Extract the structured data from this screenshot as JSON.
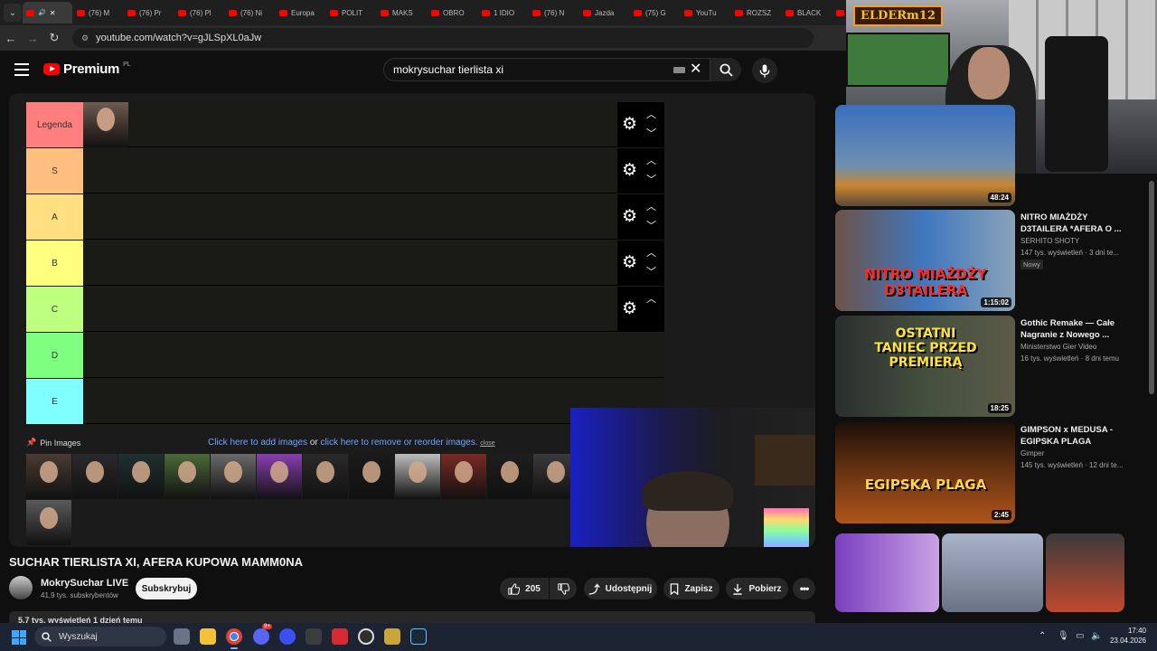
{
  "browser": {
    "tabs": [
      "",
      "(76) M",
      "(76) Pr",
      "(76) Pl",
      "(76) Ni",
      "Europa",
      "POLIT",
      "MAKS",
      "OBRO",
      "1 IDIO",
      "(76) N",
      "Jazda",
      "(75) G",
      "YouTu",
      "ROZSZ",
      "BLACK",
      "("
    ],
    "url": "youtube.com/watch?v=gJLSpXL0aJw"
  },
  "youtube": {
    "logo_word": "Premium",
    "logo_country": "PL",
    "search_query": "mokrysuchar tierlista xi"
  },
  "tierlist": {
    "tiers": [
      {
        "label": "Legenda",
        "color": "#ff7f7f"
      },
      {
        "label": "S",
        "color": "#ffbf7f"
      },
      {
        "label": "A",
        "color": "#ffdf7f"
      },
      {
        "label": "B",
        "color": "#ffff7f"
      },
      {
        "label": "C",
        "color": "#bfff7f"
      },
      {
        "label": "D",
        "color": "#7fff7f"
      },
      {
        "label": "E",
        "color": "#7fffff"
      }
    ],
    "pin_label": "Pin Images",
    "add_link": "Click here to add images",
    "or_text": "or",
    "remove_link": "click here to remove or reorder images.",
    "close_link": "close"
  },
  "stream_logo": "ELDER",
  "recommendations": [
    {
      "title": "",
      "channel": "",
      "meta": "",
      "duration": "48:24",
      "badge": ""
    },
    {
      "title": "NITRO MIAŻDŻY D3TAILERA *AFERA O ...",
      "channel": "SERHITO SHOTY",
      "meta": "147 tys. wyświetleń · 3 dni te...",
      "duration": "1:15:02",
      "badge": "Nowy",
      "thumb_text": "NITRO MIAŻDŻY D3TAILERA"
    },
    {
      "title": "Gothic Remake — Całe Nagranie z Nowego ...",
      "channel": "Ministerstwo Gier Video",
      "meta": "16 tys. wyświetleń · 8 dni temu",
      "duration": "18:25",
      "badge": "",
      "thumb_text": "OSTATNI TANIEC PRZED PREMIERĄ"
    },
    {
      "title": "GIMPSON x MEDUSA - EGIPSKA PLAGA",
      "channel": "Gimper",
      "meta": "145 tys. wyświetleń · 12 dni te...",
      "duration": "2:45",
      "badge": "",
      "thumb_text": "EGIPSKA PLAGA"
    }
  ],
  "video": {
    "title": "SUCHAR TIERLISTA XI, AFERA KUPOWA MAMM0NA",
    "channel": "MokrySuchar LIVE",
    "subscribers": "41,9 tys. subskrybentów",
    "subscribe_label": "Subskrybuj",
    "likes": "205",
    "share_label": "Udostępnij",
    "save_label": "Zapisz",
    "download_label": "Pobierz",
    "views_line": "5,7 tys. wyświetleń  1 dzień temu"
  },
  "taskbar": {
    "search_placeholder": "Wyszukaj",
    "time": "17:40",
    "date": "23.04.2026",
    "discord_badge": "9+"
  }
}
